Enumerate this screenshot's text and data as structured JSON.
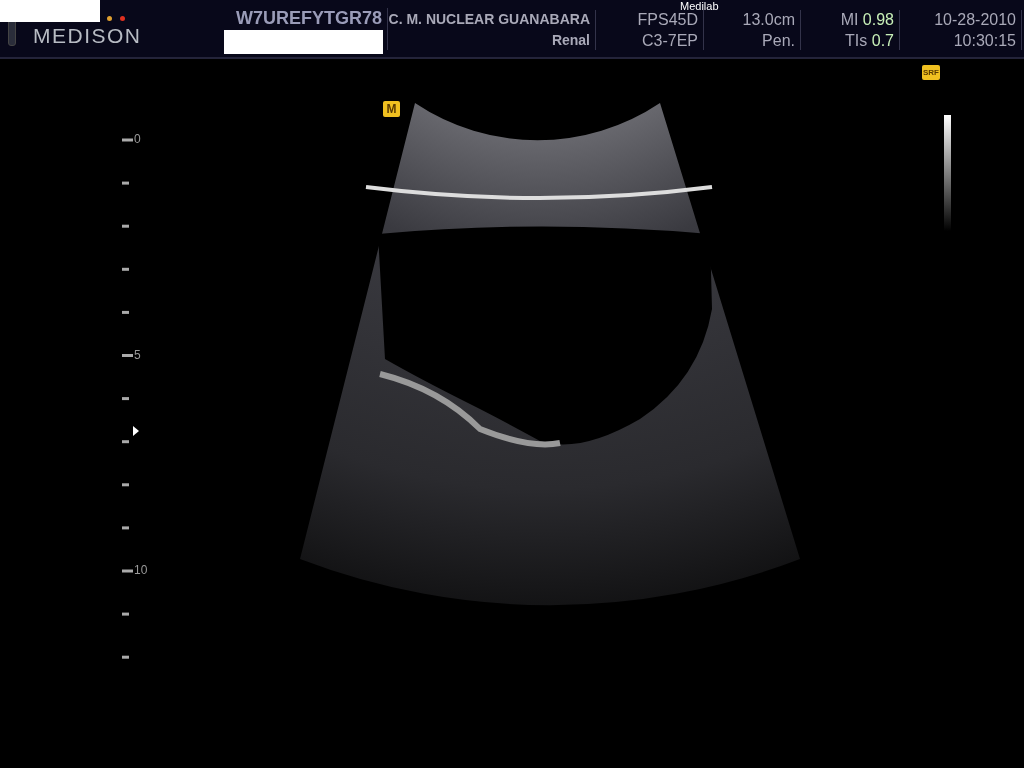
{
  "header": {
    "logo": "MEDISON",
    "patient_id": "W7UREFYTGR78",
    "institution": "C. M. NUCLEAR  GUANABARA",
    "application": "Renal",
    "preset": "FPS45D",
    "probe": "C3-7EP",
    "depth": "13.0cm",
    "mode": "Pen.",
    "mi_label": "MI",
    "mi_value": "0.98",
    "tis_label": "TIs",
    "tis_value": "0.7",
    "date": "10-28-2010",
    "time": "10:30:15",
    "site": "Medilab"
  },
  "image": {
    "m_badge": "M",
    "srf_badge": "SRF"
  },
  "depth_scale": {
    "labels": [
      "0",
      "5",
      "10"
    ]
  }
}
